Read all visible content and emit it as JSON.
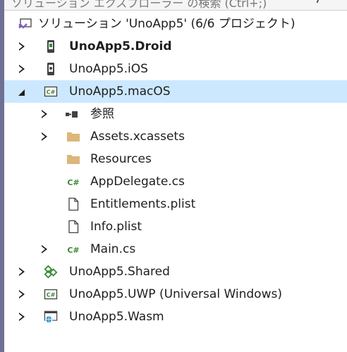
{
  "search": {
    "placeholder_visible": "ソリューション エクスプローラー の検索 (Ctrl+;)"
  },
  "tree": {
    "solution": "ソリューション 'UnoApp5' (6/6 プロジェクト)",
    "droid": "UnoApp5.Droid",
    "ios": "UnoApp5.iOS",
    "macos": "UnoApp5.macOS",
    "references": "参照",
    "assets": "Assets.xcassets",
    "resources": "Resources",
    "appdelegate": "AppDelegate.cs",
    "entitlements": "Entitlements.plist",
    "info": "Info.plist",
    "main": "Main.cs",
    "shared": "UnoApp5.Shared",
    "uwp": "UnoApp5.UWP (Universal Windows)",
    "wasm": "UnoApp5.Wasm"
  },
  "icons": {
    "csharp_glyph": "C#",
    "folder_color": "#dcb67a",
    "vs_purple": "#865fc5",
    "shared_green": "#388a34",
    "wasm_blue": "#1e88d8",
    "selection": "#cce8ff"
  }
}
